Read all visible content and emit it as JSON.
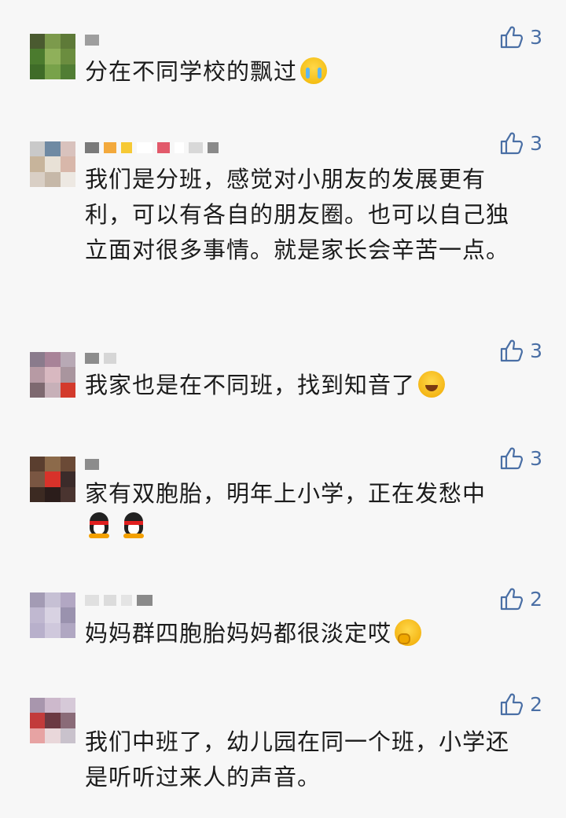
{
  "comments": [
    {
      "text": "分在不同学校的飘过",
      "likes": "3",
      "emoji": "crying-face-emoji",
      "avatar_colors": [
        "#4a5a30",
        "#7c9a4c",
        "#5e7a38",
        "#4b7b2e",
        "#8fb05a",
        "#6b8d3f",
        "#3f6c28",
        "#78a24a",
        "#517d34"
      ],
      "nick_colors": [
        "#9e9e9e"
      ]
    },
    {
      "text": "我们是分班，感觉对小朋友的发展更有利，可以有各自的朋友圈。也可以自己独立面对很多事情。就是家长会辛苦一点。",
      "likes": "3",
      "emoji": "",
      "avatar_colors": [
        "#c9c9c9",
        "#6f8aa3",
        "#d9c2bd",
        "#c7b49b",
        "#e8e1d6",
        "#d8b7aa",
        "#d9cfc5",
        "#c6b8a8",
        "#ede8e2"
      ],
      "nick_colors": [
        "#7a7a7a",
        "#f3a93c",
        "#f6c935",
        "#ffffff",
        "#e25a6b",
        "#ffffff",
        "#d8d8d8",
        "#8a8a8a"
      ]
    },
    {
      "text": "我家也是在不同班，找到知音了",
      "likes": "3",
      "emoji": "laughing-face-emoji",
      "avatar_colors": [
        "#8a7b8c",
        "#a88398",
        "#b8a9b5",
        "#b79aa4",
        "#d8b8c0",
        "#a9959e",
        "#7e6970",
        "#c7b0b8",
        "#d33a2c"
      ],
      "nick_colors": [
        "#8c8c8c",
        "#d6d6d6"
      ]
    },
    {
      "text": "家有双胞胎，明年上小学，正在发愁中",
      "likes": "3",
      "emoji": "qq-penguin-emoji",
      "avatar_colors": [
        "#5a3e2f",
        "#8c6a4a",
        "#6b4a36",
        "#7a5642",
        "#d8322a",
        "#3b2b2a",
        "#3c2a22",
        "#2b1d1b",
        "#4a3430"
      ],
      "nick_colors": [
        "#8c8c8c"
      ]
    },
    {
      "text": "妈妈群四胞胎妈妈都很淡定哎",
      "likes": "2",
      "emoji": "thinking-face-emoji",
      "avatar_colors": [
        "#a39bb4",
        "#c6c0d4",
        "#b2a7c3",
        "#c0b8d0",
        "#d8d2e2",
        "#9a92ae",
        "#b8b0cb",
        "#cfc8dc",
        "#b0a7c2"
      ],
      "nick_colors": [
        "#e0e0e0",
        "#dcdcdc",
        "#e4e4e4",
        "#8a8a8a"
      ]
    },
    {
      "text": "我们中班了，幼儿园在同一个班，小学还是听听过来人的声音。",
      "likes": "2",
      "emoji": "",
      "avatar_colors": [
        "#a896ad",
        "#cdb9cc",
        "#d6c9d8",
        "#c23b3b",
        "#6b3942",
        "#8a6b78",
        "#e7a3a3",
        "#e9d7da",
        "#c9c2cc"
      ],
      "nick_colors": []
    }
  ],
  "colors": {
    "background": "#f7f7f7",
    "like_blue": "#4a6fa5",
    "text": "#1b1b1b"
  }
}
